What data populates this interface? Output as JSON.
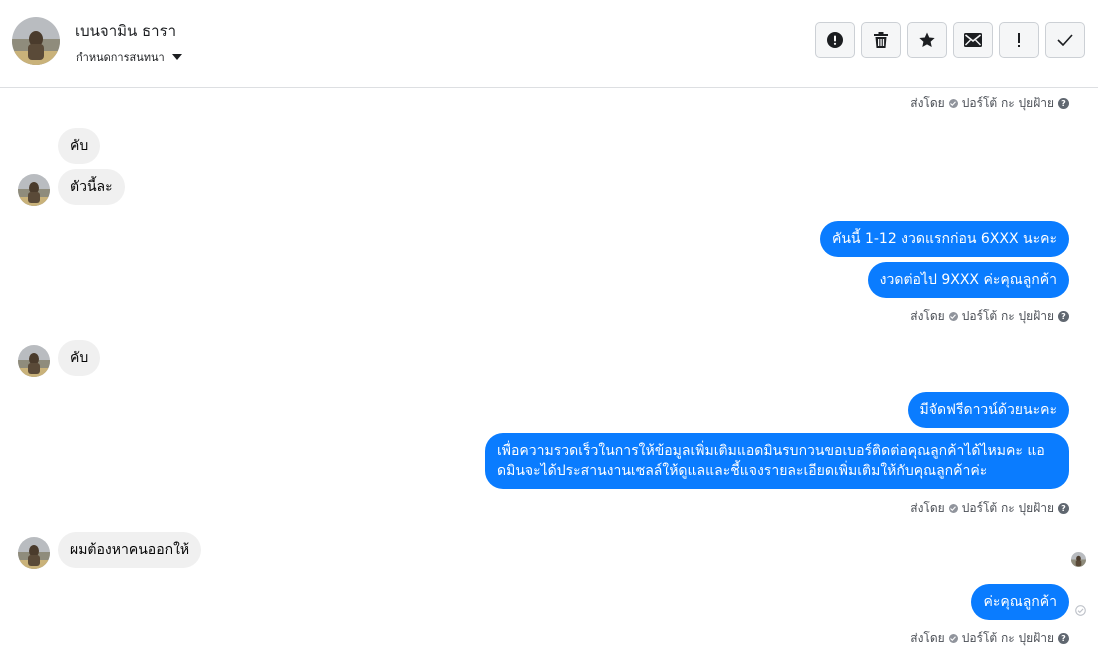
{
  "header": {
    "contact_name": "เบนจามิน ธารา",
    "label_select": "กำหนดการสนทนา",
    "toolbar": {
      "spam_icon": "alert-circle-icon",
      "delete_icon": "trash-icon",
      "star_icon": "star-icon",
      "unread_icon": "envelope-icon",
      "follow_up_icon": "exclamation-icon",
      "done_icon": "checkmark-icon"
    }
  },
  "sent_by": {
    "prefix": "ส่งโดย",
    "name": "ปอร์โต้ กะ ปุยฝ้าย",
    "help": "?"
  },
  "messages": {
    "m1": "คับ",
    "m2": "ตัวนี้ละ",
    "m3": "คันนี้ 1-12 งวดแรกก่อน 6XXX นะคะ",
    "m4": "งวดต่อไป 9XXX ค่ะคุณลูกค้า",
    "m5": "คับ",
    "m6": "มีจัดฟรีดาวน์ด้วยนะคะ",
    "m7": "เพื่อความรวดเร็วในการให้ข้อมูลเพิ่มเติมแอดมินรบกวนขอเบอร์ติดต่อคุณลูกค้าได้ไหมคะ แอดมินจะได้ประสานงานเซลล์ให้ดูแลและชี้แจงรายละเอียดเพิ่มเติมให้กับคุณลูกค้าค่ะ",
    "m8": "ผมต้องหาคนออกให้",
    "m9": "ค่ะคุณลูกค้า"
  },
  "colors": {
    "outgoing_bubble": "#0a7cff",
    "incoming_bubble": "#f0f0f0"
  }
}
